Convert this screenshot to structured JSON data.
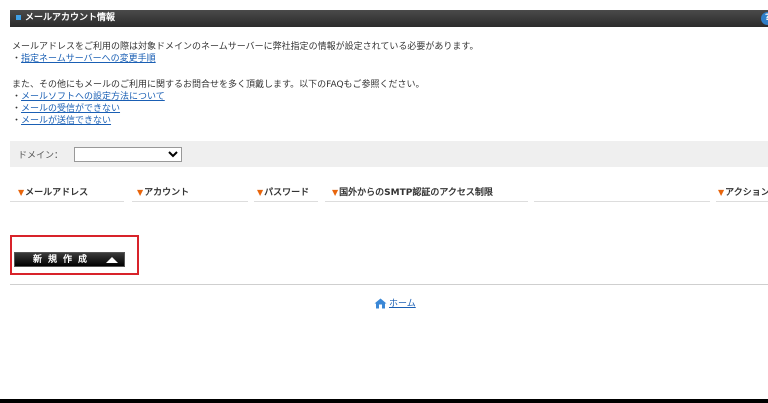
{
  "header": {
    "title": "メールアカウント情報",
    "help_label": "?"
  },
  "intro": {
    "line1": "メールアドレスをご利用の際は対象ドメインのネームサーバーに弊社指定の情報が設定されている必要があります。",
    "link1": "指定ネームサーバーへの変更手順",
    "line2": "また、その他にもメールのご利用に関するお問合せを多く頂戴します。以下のFAQもご参照ください。",
    "links": [
      "メールソフトへの設定方法について",
      "メールの受信ができない",
      "メールが送信できない"
    ],
    "bullet": "・"
  },
  "domain": {
    "label": "ドメイン：",
    "selected": ""
  },
  "table": {
    "columns": [
      "メールアドレス",
      "アカウント",
      "パスワード",
      "国外からのSMTP認証のアクセス制限",
      "アクション"
    ],
    "sort_marker": "▼"
  },
  "actions": {
    "new_label": "新規作成"
  },
  "footer": {
    "home_label": "ホーム"
  },
  "colors": {
    "accent_red": "#d8232a",
    "sort_orange": "#e8650c",
    "link_blue": "#1a5fb4"
  }
}
